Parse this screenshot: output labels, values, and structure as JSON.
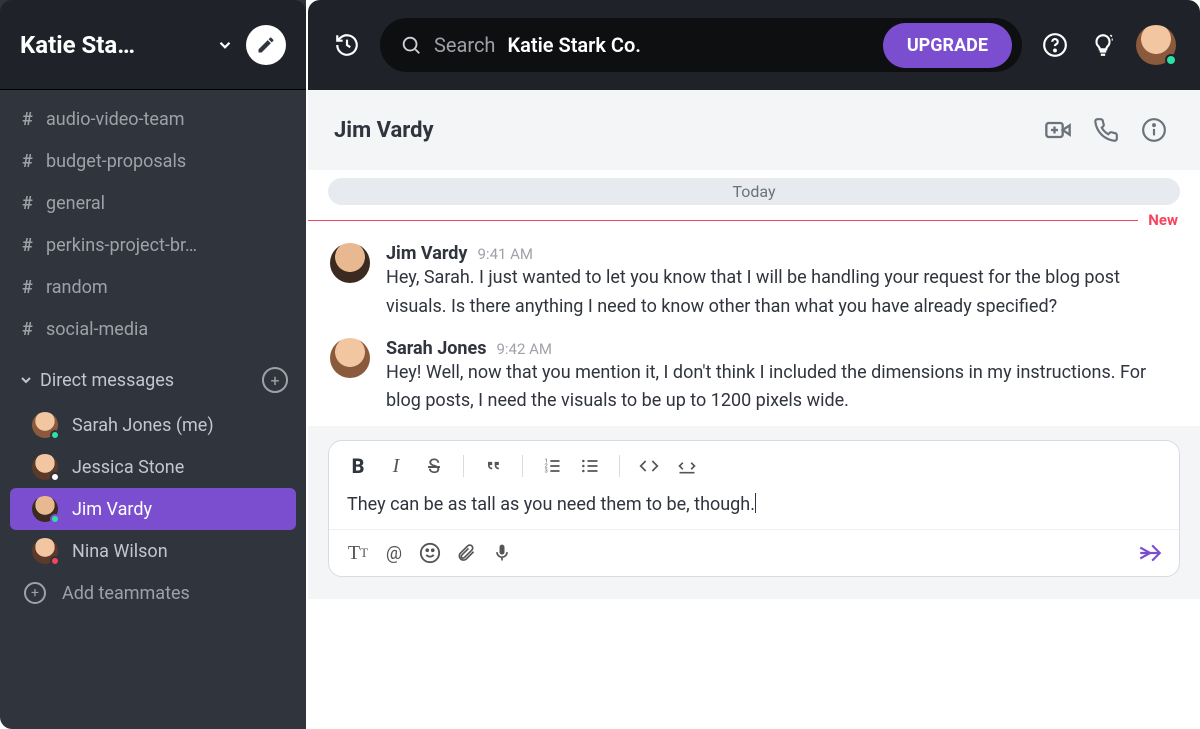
{
  "workspace": {
    "name": "Katie Sta…"
  },
  "search": {
    "label": "Search",
    "value": "Katie Stark Co."
  },
  "upgrade_label": "UPGRADE",
  "channels": [
    "audio-video-team",
    "budget-proposals",
    "general",
    "perkins-project-br…",
    "random",
    "social-media"
  ],
  "dm_section": {
    "title": "Direct messages"
  },
  "dms": [
    {
      "name": "Sarah Jones (me)",
      "status": "online"
    },
    {
      "name": "Jessica Stone",
      "status": "offline"
    },
    {
      "name": "Jim Vardy",
      "status": "online",
      "active": true
    },
    {
      "name": "Nina Wilson",
      "status": "busy"
    }
  ],
  "add_teammates": "Add teammates",
  "chat": {
    "title": "Jim Vardy",
    "day": "Today",
    "new_label": "New",
    "messages": [
      {
        "author": "Jim Vardy",
        "time": "9:41 AM",
        "body": "Hey, Sarah. I just wanted to let you know that I will be handling your request for the blog post visuals. Is there anything I need to know other than what you have already specified?"
      },
      {
        "author": "Sarah Jones",
        "time": "9:42 AM",
        "body": "Hey! Well, now that you mention it, I don't think I included the dimensions in my instructions. For blog posts, I need the visuals to be up to 1200 pixels wide."
      }
    ],
    "draft": "They can be as tall as you need them to be, though."
  }
}
